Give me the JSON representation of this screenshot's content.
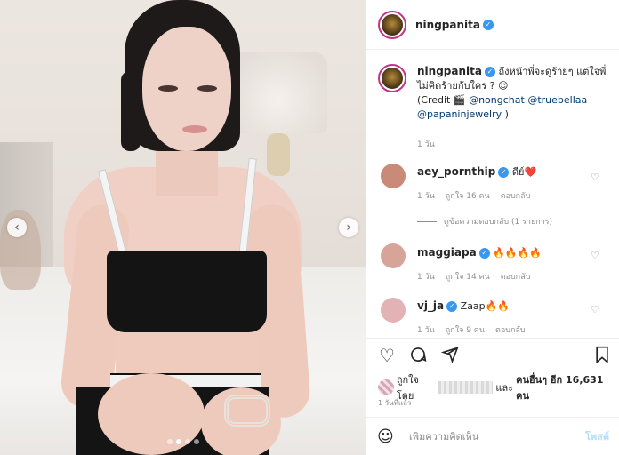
{
  "post": {
    "username": "ningpanita",
    "verified_mark": "✓",
    "caption": {
      "text": "ถึงหน้าพี่จะดูร้ายๆ แต่ใจพี่ไม่คิดร้ายกับใคร ?",
      "emoji": "😌",
      "credit_prefix": "(Credit",
      "credit_icon": "🎬",
      "mentions": [
        "@nongchat",
        "@truebellaa",
        "@papaninjewelry"
      ],
      "credit_suffix": ")"
    },
    "caption_time": "1 วัน"
  },
  "comments": [
    {
      "username": "aey_pornthip",
      "verified": true,
      "text": "ดีย์",
      "emoji": "❤️",
      "time": "1 วัน",
      "likes": "ถูกใจ 16 คน",
      "reply": "ตอบกลับ",
      "avatar_color": "#c98a7a"
    },
    {
      "username": "maggiapa",
      "verified": true,
      "text": "",
      "emoji": "🔥🔥🔥🔥",
      "time": "1 วัน",
      "likes": "ถูกใจ 14 คน",
      "reply": "ตอบกลับ",
      "avatar_color": "#d7a49a"
    },
    {
      "username": "vj_ja",
      "verified": true,
      "text": "Zaap",
      "emoji": "🔥🔥",
      "time": "1 วัน",
      "likes": "ถูกใจ 9 คน",
      "reply": "ตอบกลับ",
      "avatar_color": "#e2b2b4"
    }
  ],
  "view_replies": "ดูข้อความตอบกลับ (1 รายการ)",
  "likes_line": {
    "prefix": "ถูกใจโดย",
    "middle": "และ",
    "suffix": "คนอื่นๆ อีก 16,631 คน"
  },
  "time_ago": "1 วันที่แล้ว",
  "add_comment": {
    "placeholder": "เพิ่มความคิดเห็น",
    "post_label": "โพสต์"
  },
  "icons": [
    "heart-icon",
    "comment-icon",
    "share-icon",
    "bookmark-icon",
    "emoji-icon",
    "chevron-left-icon",
    "chevron-right-icon"
  ],
  "carousel": {
    "slides": 4,
    "active": 1
  },
  "colors": {
    "verified": "#3897f0",
    "mention": "#00376b",
    "post_button": "#b2dffc",
    "story_ring": "#c13584"
  }
}
